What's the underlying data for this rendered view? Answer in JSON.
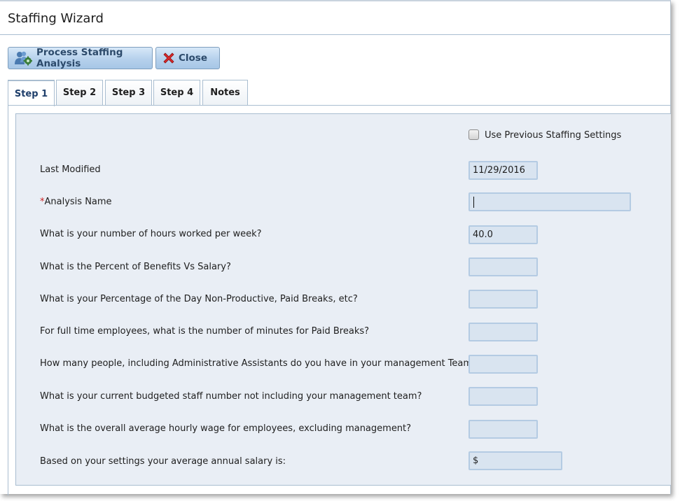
{
  "window": {
    "title": "Staffing Wizard"
  },
  "toolbar": {
    "process_label": "Process Staffing Analysis",
    "close_label": "Close"
  },
  "tabs": [
    {
      "label": "Step 1",
      "active": true
    },
    {
      "label": "Step 2",
      "active": false
    },
    {
      "label": "Step 3",
      "active": false
    },
    {
      "label": "Step 4",
      "active": false
    },
    {
      "label": "Notes",
      "active": false
    }
  ],
  "form": {
    "use_previous_label": "Use Previous Staffing Settings",
    "use_previous_checked": false,
    "required_marker": "*",
    "fields": [
      {
        "label": "Last Modified",
        "value": "11/29/2016"
      },
      {
        "label": "Analysis Name",
        "value": ""
      },
      {
        "label": "What is your number of hours worked per week?",
        "value": "40.0"
      },
      {
        "label": "What is the Percent of Benefits Vs Salary?",
        "value": ""
      },
      {
        "label": "What is your Percentage of the Day Non-Productive, Paid Breaks, etc?",
        "value": ""
      },
      {
        "label": "For full time employees, what is the number of minutes for Paid Breaks?",
        "value": ""
      },
      {
        "label": "How many people, including Administrative Assistants do you have in your management Team?",
        "value": ""
      },
      {
        "label": "What is your current budgeted staff number not including your management team?",
        "value": ""
      },
      {
        "label": "What is the overall average hourly wage for employees, excluding management?",
        "value": ""
      },
      {
        "label": "Based on your settings your average annual salary is:",
        "value": "$"
      }
    ]
  },
  "icons": {
    "process": "people-gear-icon",
    "close": "red-x-icon"
  },
  "colors": {
    "panel_bg": "#e9eef5",
    "input_bg": "#d9e4f0",
    "button_text": "#2c4a6b",
    "required": "#cc2222"
  }
}
